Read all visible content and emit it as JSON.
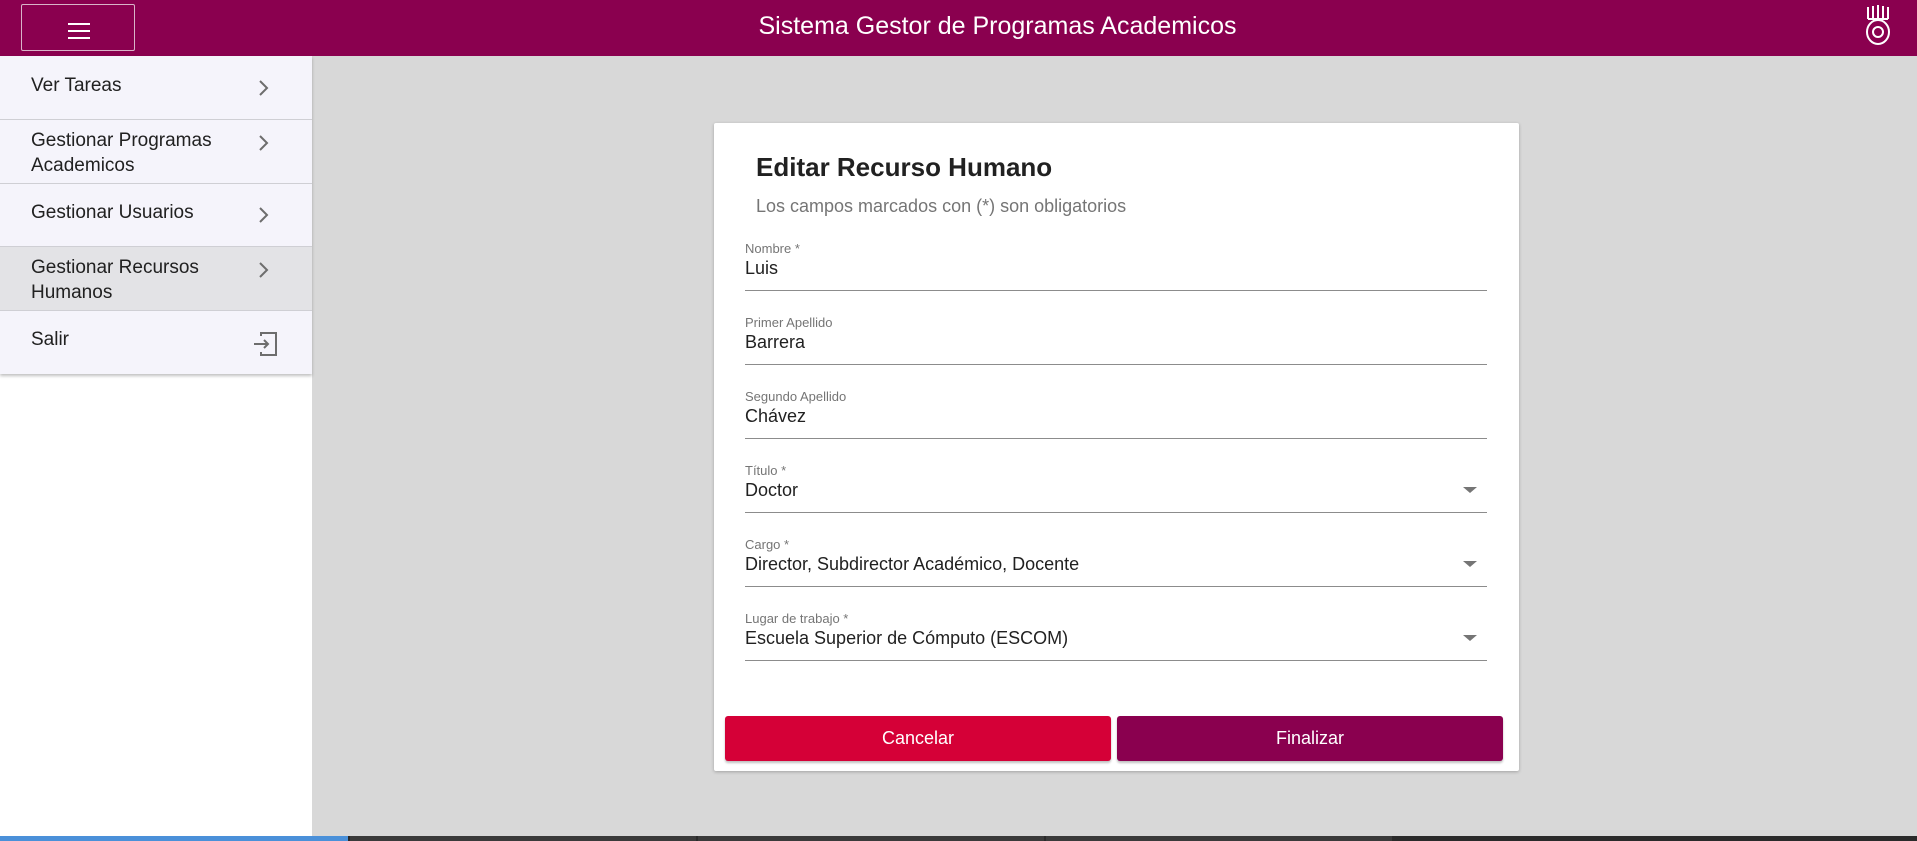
{
  "header": {
    "title": "Sistema Gestor de Programas Academicos",
    "menu_icon": "hamburger-icon",
    "logo_icon": "ipn-logo-icon",
    "color": "#8a004f"
  },
  "sidebar": {
    "items": [
      {
        "line1": "Ver Tareas",
        "line2": "",
        "icon": "chevron-right-icon"
      },
      {
        "line1": "Gestionar Programas",
        "line2": "Academicos",
        "icon": "chevron-right-icon"
      },
      {
        "line1": "Gestionar Usuarios",
        "line2": "",
        "icon": "chevron-right-icon"
      },
      {
        "line1": "Gestionar Recursos",
        "line2": "Humanos",
        "icon": "chevron-right-icon",
        "active": true
      },
      {
        "line1": "Salir",
        "line2": "",
        "icon": "exit-icon"
      }
    ]
  },
  "form": {
    "title": "Editar Recurso Humano",
    "subtitle": "Los campos marcados con (*) son obligatorios",
    "fields": {
      "nombre": {
        "label": "Nombre *",
        "value": "Luis"
      },
      "primer_apellido": {
        "label": "Primer Apellido",
        "value": "Barrera"
      },
      "segundo_apellido": {
        "label": "Segundo Apellido",
        "value": "Chávez"
      },
      "titulo": {
        "label": "Título *",
        "value": "Doctor"
      },
      "cargo": {
        "label": "Cargo *",
        "value": "Director, Subdirector Académico, Docente"
      },
      "lugar_trabajo": {
        "label": "Lugar de trabajo *",
        "value": "Escuela Superior de Cómputo (ESCOM)"
      }
    },
    "buttons": {
      "cancel": "Cancelar",
      "finish": "Finalizar"
    }
  },
  "colors": {
    "primary": "#8a004f",
    "cancel": "#d50037",
    "background": "#d8d8d8"
  }
}
